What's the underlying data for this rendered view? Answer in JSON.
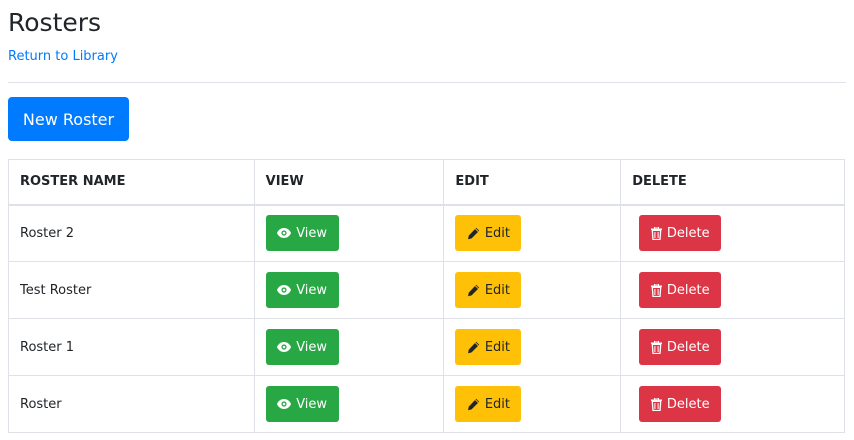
{
  "page": {
    "title": "Rosters",
    "back_link": "Return to Library",
    "new_button": "New Roster"
  },
  "table": {
    "headers": [
      "ROSTER NAME",
      "VIEW",
      "EDIT",
      "DELETE"
    ],
    "rows": [
      {
        "name": "Roster 2"
      },
      {
        "name": "Test Roster"
      },
      {
        "name": "Roster 1"
      },
      {
        "name": "Roster"
      }
    ]
  },
  "actions": {
    "view_label": "View",
    "edit_label": "Edit",
    "delete_label": "Delete"
  },
  "icons": {
    "view": "eye-icon",
    "edit": "pencil-icon",
    "delete": "trash-icon"
  },
  "colors": {
    "primary": "#007bff",
    "success": "#28a745",
    "warning": "#ffc107",
    "danger": "#dc3545"
  }
}
